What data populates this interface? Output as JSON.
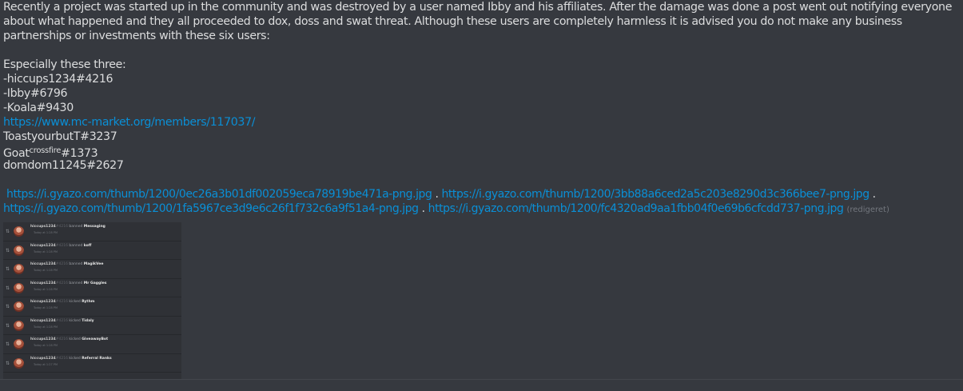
{
  "message": {
    "intro": "Recently a project was started up in the community and was destroyed by a user named Ibby and his affiliates. After the damage was done a post went out notifying everyone about what happened and they all proceeded to dox, doss and swat threat. Although these users are completely harmless it is advised you do not make any business partnerships or investments with these six users:",
    "especially": "Especially these three:",
    "users_top": [
      "-hiccups1234#4216",
      "-Ibby#6796",
      "-Koala#9430"
    ],
    "member_link": "https://www.mc-market.org/members/117037/",
    "user_toasty": "ToastyourbutT#3237",
    "goat_prefix": "Goat",
    "goat_sup": "crossfire",
    "goat_suffix": "#1373",
    "user_domdom": "domdom11245#2627",
    "links": [
      "https://i.gyazo.com/thumb/1200/0ec26a3b01df002059eca78919be471a-png.jpg",
      "https://i.gyazo.com/thumb/1200/3bb88a6ced2a5c203e8290d3c366bee7-png.jpg",
      "https://i.gyazo.com/thumb/1200/1fa5967ce3d9e6c26f1f732c6a9f51a4-png.jpg",
      "https://i.gyazo.com/thumb/1200/fc4320ad9aa1fbb04f0e69b6cfcdd737-png.jpg"
    ],
    "separator": ".",
    "edited_label": "(redigeret)"
  },
  "embed": {
    "rows": [
      {
        "user": "hiccups1234",
        "tag": "#4216",
        "action": "banned",
        "target": "Messaging",
        "time": "Today at 1:28 PM"
      },
      {
        "user": "hiccups1234",
        "tag": "#4216",
        "action": "banned",
        "target": "koff",
        "time": "Today at 1:28 PM"
      },
      {
        "user": "hiccups1234",
        "tag": "#4216",
        "action": "banned",
        "target": "MagikVee",
        "time": "Today at 1:28 PM"
      },
      {
        "user": "hiccups1234",
        "tag": "#4216",
        "action": "banned",
        "target": "Mr Gaggles",
        "time": "Today at 1:28 PM"
      },
      {
        "user": "hiccups1234",
        "tag": "#4216",
        "action": "kicked",
        "target": "Rythm",
        "time": "Today at 1:28 PM"
      },
      {
        "user": "hiccups1234",
        "tag": "#4216",
        "action": "kicked",
        "target": "Tidaly",
        "time": "Today at 1:28 PM"
      },
      {
        "user": "hiccups1234",
        "tag": "#4216",
        "action": "kicked",
        "target": "GiveawayBot",
        "time": "Today at 1:28 PM"
      },
      {
        "user": "hiccups1234",
        "tag": "#4216",
        "action": "kicked",
        "target": "Referral Ranks",
        "time": "Today at 1:27 PM"
      }
    ]
  }
}
